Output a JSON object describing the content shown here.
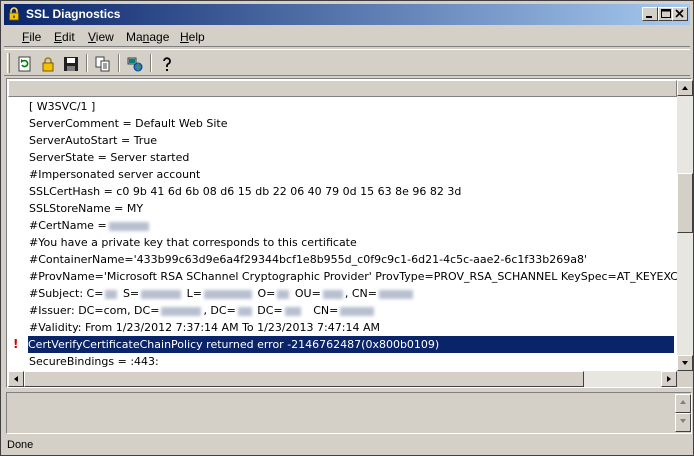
{
  "window": {
    "title": "SSL Diagnostics"
  },
  "menu": [
    {
      "accel": "F",
      "rest": "ile"
    },
    {
      "accel": "E",
      "rest": "dit"
    },
    {
      "accel": "V",
      "rest": "iew"
    },
    {
      "pre": "Ma",
      "accel": "n",
      "rest": "age"
    },
    {
      "accel": "H",
      "rest": "elp"
    }
  ],
  "toolbar": {
    "buttons": [
      "refresh-icon",
      "lock-icon",
      "save-icon",
      "copy-icon",
      "network-icon",
      "help-icon"
    ]
  },
  "log": {
    "lines": [
      "[ W3SVC/1 ]",
      "ServerComment = Default Web Site",
      "ServerAutoStart = True",
      "ServerState = Server started",
      "#Impersonated server account",
      "SSLCertHash = c0 9b 41 6d 6b 08 d6 15 db 22 06 40 79 0d 15 63 8e 96 82 3d",
      "SSLStoreName = MY",
      "#CertName =",
      "#You have a private key that corresponds to this certificate",
      "#ContainerName='433b99c63d9e6a4f29344bcf1e8b955d_c0f9c9c1-6d21-4c5c-aae2-6c1f33b269a8'",
      "#ProvName='Microsoft RSA SChannel Cryptographic Provider' ProvType=PROV_RSA_SCHANNEL KeySpec=AT_KEYEXCHANGE",
      "#Subject:",
      "#Issuer:",
      "#Validity: From 1/23/2012 7:37:14 AM To 1/23/2013 7:47:14 AM",
      "CertVerifyCertificateChainPolicy returned error -2146762487(0x800b0109)",
      "SecureBindings = :443:"
    ],
    "subject_parts": [
      "C=",
      "S=",
      "L=",
      "O=",
      "OU=",
      ", CN="
    ],
    "issuer_parts": [
      "DC=com, DC=",
      ", DC=",
      " DC=",
      "CN="
    ],
    "error_marker": "!"
  },
  "status": {
    "text": "Done"
  },
  "colors": {
    "titlebar": "#0a246a",
    "selection": "#0a246a",
    "error": "#d00000"
  }
}
